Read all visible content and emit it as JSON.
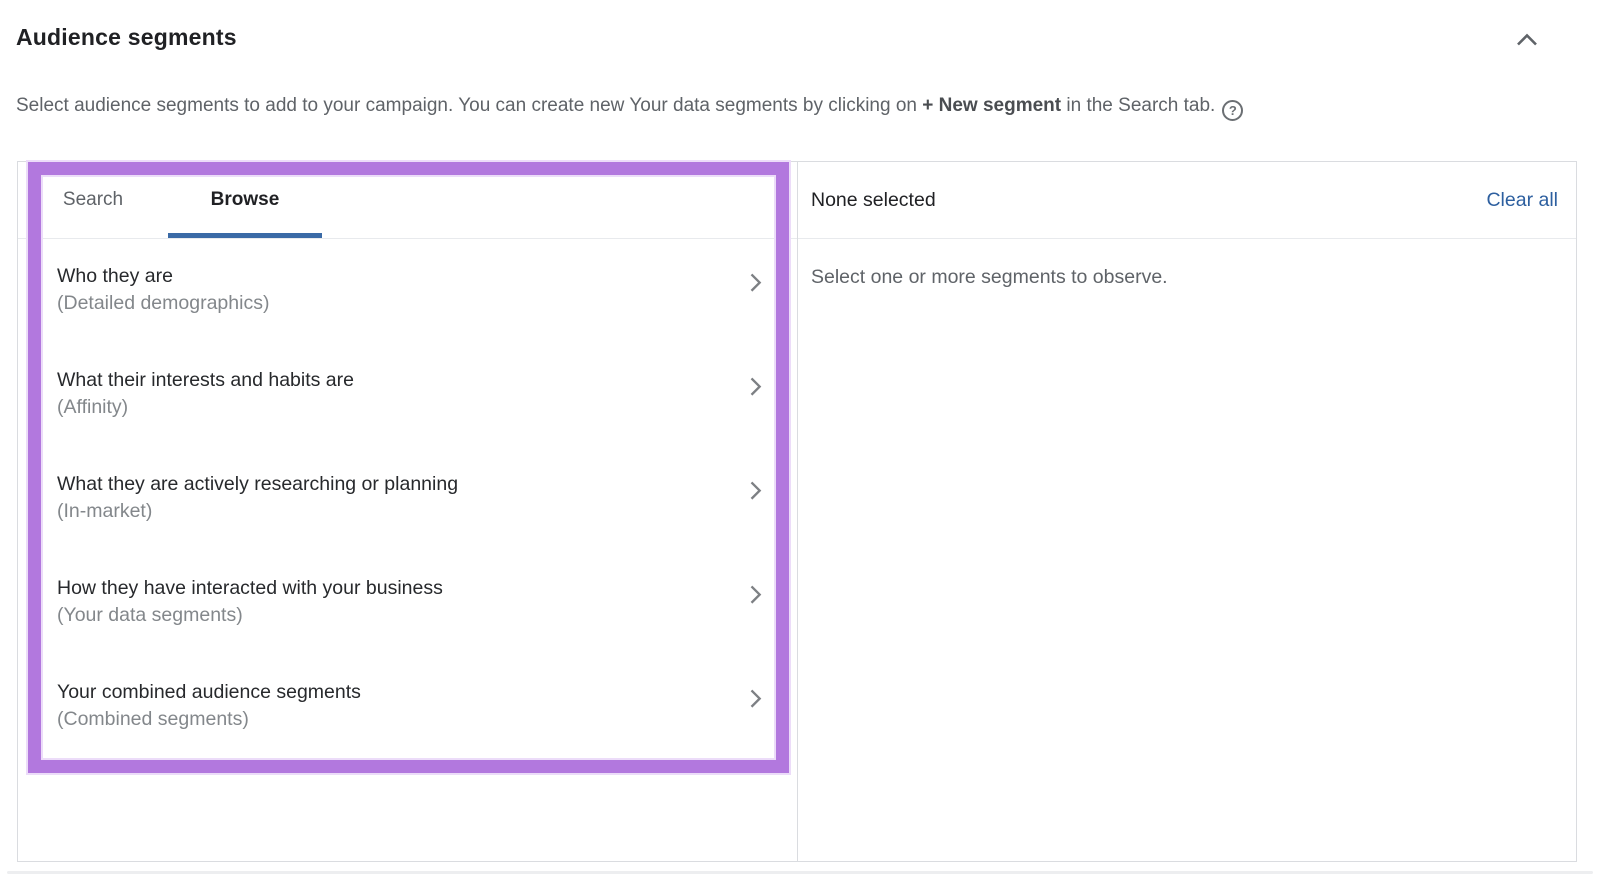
{
  "colors": {
    "accent_blue": "#3a6aa6",
    "link_blue": "#2d5f9f",
    "annotation_purple": "#b278de"
  },
  "icons": {
    "collapse": "chevron-up",
    "help": "question-mark-circle",
    "category_arrow": "chevron-right"
  },
  "header": {
    "title": "Audience segments",
    "description_prefix": "Select audience segments to add to your campaign. You can create new Your data segments by clicking on ",
    "description_bold": "+ New segment",
    "description_suffix": " in the Search tab.",
    "help_glyph": "?"
  },
  "browser_panel": {
    "tabs": [
      {
        "label": "Search",
        "active": false
      },
      {
        "label": "Browse",
        "active": true
      }
    ],
    "categories": [
      {
        "title": "Who they are",
        "subtitle": "(Detailed demographics)"
      },
      {
        "title": "What their interests and habits are",
        "subtitle": "(Affinity)"
      },
      {
        "title": "What they are actively researching or planning",
        "subtitle": "(In-market)"
      },
      {
        "title": "How they have interacted with your business",
        "subtitle": "(Your data segments)"
      },
      {
        "title": "Your combined audience segments",
        "subtitle": "(Combined segments)"
      }
    ]
  },
  "selection_panel": {
    "status": "None selected",
    "clear_all_label": "Clear all",
    "empty_message": "Select one or more segments to observe."
  }
}
